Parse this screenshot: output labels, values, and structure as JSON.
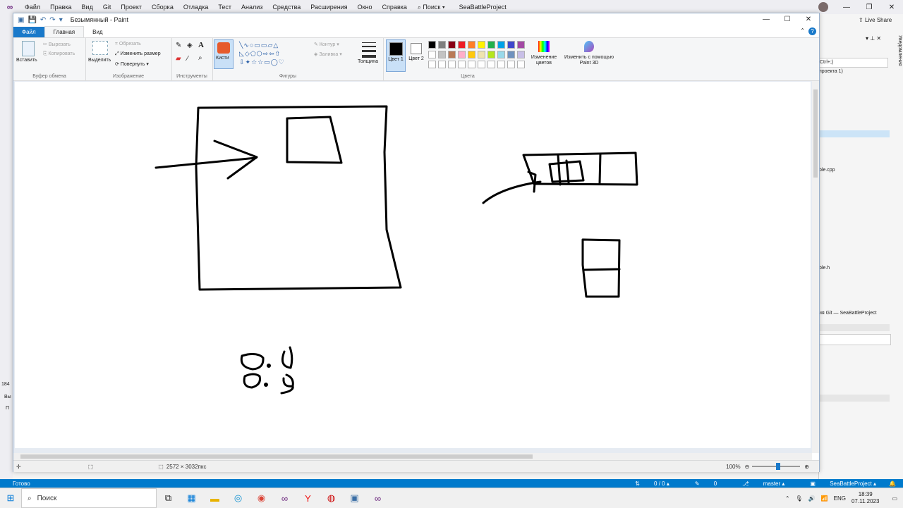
{
  "vs": {
    "menu": [
      "Файл",
      "Правка",
      "Вид",
      "Git",
      "Проект",
      "Сборка",
      "Отладка",
      "Тест",
      "Анализ",
      "Средства",
      "Расширения",
      "Окно",
      "Справка"
    ],
    "search": "Поиск",
    "project": "SeaBattleProject",
    "live_share": "Live Share",
    "side_search": "Ctrl+;)",
    "side_proj": "проекта 1)",
    "file_cpp": "ble.cpp",
    "file_h": "ble.h",
    "git_label": "ия Git — SeaBattleProject",
    "notifications": "Уведомления",
    "status_ready": "Готово",
    "status_changes": "0 / 0",
    "status_pencil": "0",
    "status_branch": "master",
    "status_project": "SeaBattleProject",
    "left_num": "184",
    "left_vy": "Вы",
    "left_p": "П"
  },
  "paint": {
    "title": "Безымянный - Paint",
    "tabs": [
      "Файл",
      "Главная",
      "Вид"
    ],
    "groups": {
      "clipboard": "Буфер обмена",
      "image": "Изображение",
      "tools": "Инструменты",
      "shapes": "Фигуры",
      "colors": "Цвета"
    },
    "buttons": {
      "paste": "Вставить",
      "cut": "Вырезать",
      "copy": "Копировать",
      "select": "Выделить",
      "crop": "Обрезать",
      "resize": "Изменить размер",
      "rotate": "Повернуть",
      "brushes": "Кисти",
      "outline": "Контур",
      "fill": "Заливка",
      "thickness": "Толщина",
      "color1": "Цвет 1",
      "color2": "Цвет 2",
      "edit_colors": "Изменение цветов",
      "paint3d": "Изменить с помощью Paint 3D"
    },
    "palette_row1": [
      "#000000",
      "#7f7f7f",
      "#880015",
      "#ed1c24",
      "#ff7f27",
      "#fff200",
      "#22b14c",
      "#00a2e8",
      "#3f48cc",
      "#a349a4"
    ],
    "palette_row2": [
      "#ffffff",
      "#c3c3c3",
      "#b97a57",
      "#ffaec9",
      "#ffc90e",
      "#efe4b0",
      "#b5e61d",
      "#99d9ea",
      "#7092be",
      "#c8bfe7"
    ],
    "status_size": "2572 × 3032пкс",
    "zoom": "100%"
  },
  "taskbar": {
    "search": "Поиск",
    "lang": "ENG",
    "time": "18:39",
    "date": "07.11.2023"
  }
}
